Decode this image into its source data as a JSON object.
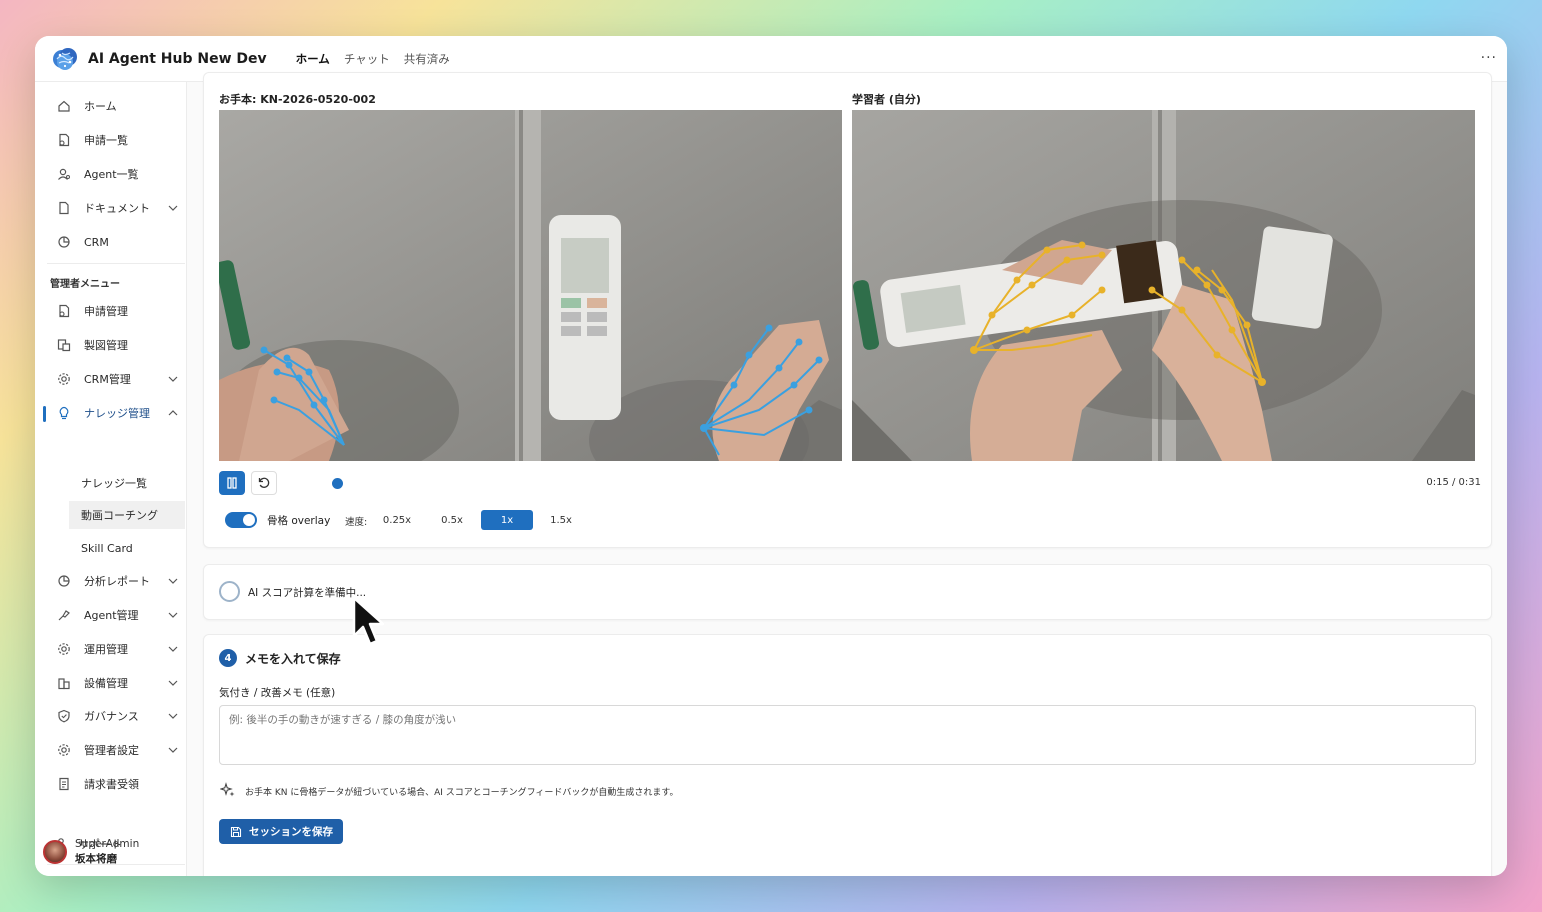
{
  "app": {
    "title": "AI Agent Hub New Dev",
    "more_label": "···"
  },
  "tabs": [
    {
      "label": "ホーム"
    },
    {
      "label": "チャット"
    },
    {
      "label": "共有済み"
    }
  ],
  "sidebar": {
    "items": [
      {
        "label": "ホーム",
        "icon": "home-icon"
      },
      {
        "label": "申請一覧",
        "icon": "request-icon"
      },
      {
        "label": "Agent一覧",
        "icon": "agent-icon"
      },
      {
        "label": "ドキュメント",
        "icon": "document-icon",
        "expandable": true
      },
      {
        "label": "CRM",
        "icon": "crm-icon"
      }
    ],
    "admin_section_label": "管理者メニュー",
    "admin_items": [
      {
        "label": "申請管理",
        "icon": "request-icon"
      },
      {
        "label": "製図管理",
        "icon": "drawing-icon"
      },
      {
        "label": "CRM管理",
        "icon": "gear-icon",
        "expandable": true
      },
      {
        "label": "ナレッジ管理",
        "icon": "lightbulb-icon",
        "expandable": true,
        "expanded": true,
        "selected": true
      }
    ],
    "knowledge_sub": [
      {
        "label": "ナレッジ一覧"
      },
      {
        "label": "動画コーチング",
        "active": true
      },
      {
        "label": "Skill Card"
      }
    ],
    "more_items": [
      {
        "label": "分析レポート",
        "icon": "report-icon",
        "expandable": true
      },
      {
        "label": "Agent管理",
        "icon": "agent-manage-icon",
        "expandable": true
      },
      {
        "label": "運用管理",
        "icon": "gear-icon",
        "expandable": true
      },
      {
        "label": "設備管理",
        "icon": "building-icon",
        "expandable": true
      },
      {
        "label": "ガバナンス",
        "icon": "shield-icon",
        "expandable": true
      },
      {
        "label": "管理者設定",
        "icon": "gear-icon",
        "expandable": true
      },
      {
        "label": "請求書受領",
        "icon": "invoice-icon"
      }
    ],
    "support_label": "サポート",
    "user": {
      "role": "SuperAdmin",
      "name": "坂本将磨"
    }
  },
  "video_section": {
    "reference_label": "お手本: KN-2026-0520-002",
    "learner_label": "学習者 (自分)",
    "time": "0:15 / 0:31",
    "progress": 0.48,
    "overlay_label": "骨格 overlay",
    "overlay_on": true,
    "speed_label": "速度:",
    "speeds": [
      "0.25x",
      "0.5x",
      "1x",
      "1.5x"
    ],
    "active_speed": "1x"
  },
  "score_section": {
    "status": "AI スコア計算を準備中..."
  },
  "memo_section": {
    "step_number": "4",
    "title": "メモを入れて保存",
    "field_label": "気付き / 改善メモ (任意)",
    "placeholder": "例: 後半の手の動きが速すぎる / 膝の角度が浅い",
    "hint": "お手本 KN に骨格データが紐づいている場合、AI スコアとコーチングフィードバックが自動生成されます。",
    "save_label": "セッションを保存"
  },
  "colors": {
    "accent": "#1f6fbf",
    "save_button": "#1f5fa8",
    "skeleton_reference": "#3aa0e0",
    "skeleton_learner": "#e8b22a"
  }
}
